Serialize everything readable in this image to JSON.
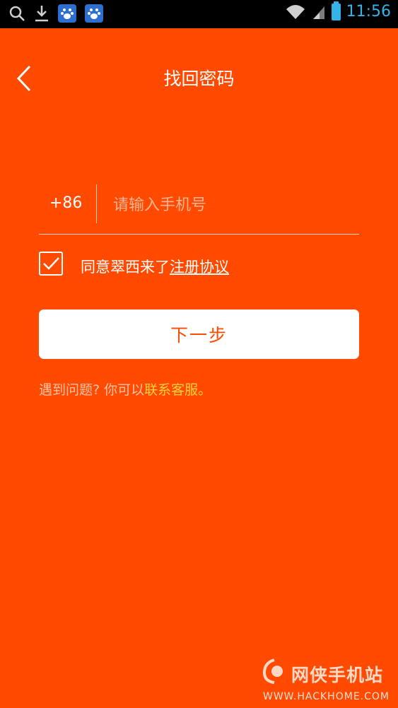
{
  "statusbar": {
    "time": "11:56",
    "icons": [
      "search-icon",
      "download-icon",
      "baidu-paw-icon",
      "baidu-paw-icon",
      "wifi-icon",
      "signal-icon",
      "battery-icon"
    ]
  },
  "header": {
    "title": "找回密码",
    "back_icon": "chevron-left-icon"
  },
  "phone": {
    "country_code": "+86",
    "placeholder": "请输入手机号",
    "value": ""
  },
  "agreement": {
    "checked": true,
    "text": "同意翠西来了",
    "link": "注册协议"
  },
  "next_button": {
    "label": "下一步"
  },
  "help": {
    "text": "遇到问题? 你可以",
    "link": "联系客服。"
  },
  "watermark": {
    "cn": "网侠手机站",
    "en": "WWW.HACKHOME.COM"
  },
  "colors": {
    "background": "#ff4a00",
    "statusbar": "#000000",
    "accent_link": "#ffd23b",
    "button_bg": "#ffffff",
    "button_text": "#ff4a00"
  }
}
